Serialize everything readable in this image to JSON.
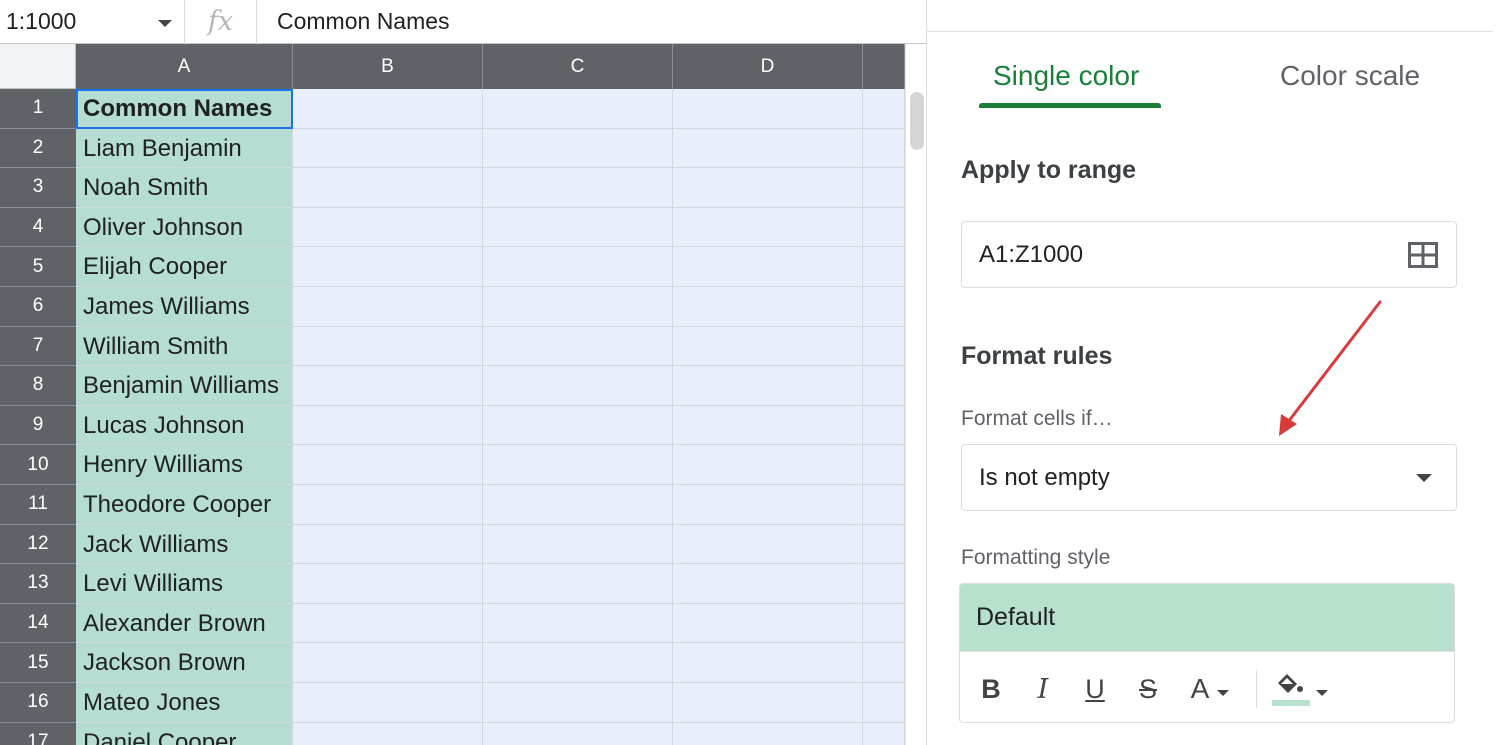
{
  "formula_bar": {
    "name_box": "1:1000",
    "fx_label": "fx",
    "value": "Common Names"
  },
  "grid": {
    "columns": [
      "A",
      "B",
      "C",
      "D"
    ],
    "rows": [
      {
        "num": "1",
        "a": "Common Names"
      },
      {
        "num": "2",
        "a": "Liam Benjamin"
      },
      {
        "num": "3",
        "a": "Noah Smith"
      },
      {
        "num": "4",
        "a": "Oliver Johnson"
      },
      {
        "num": "5",
        "a": "Elijah Cooper"
      },
      {
        "num": "6",
        "a": "James Williams"
      },
      {
        "num": "7",
        "a": "William Smith"
      },
      {
        "num": "8",
        "a": "Benjamin Williams"
      },
      {
        "num": "9",
        "a": "Lucas Johnson"
      },
      {
        "num": "10",
        "a": "Henry Williams"
      },
      {
        "num": "11",
        "a": "Theodore Cooper"
      },
      {
        "num": "12",
        "a": "Jack Williams"
      },
      {
        "num": "13",
        "a": "Levi Williams"
      },
      {
        "num": "14",
        "a": "Alexander Brown"
      },
      {
        "num": "15",
        "a": "Jackson Brown"
      },
      {
        "num": "16",
        "a": "Mateo Jones"
      },
      {
        "num": "17",
        "a": "Daniel Cooper"
      }
    ]
  },
  "panel": {
    "tabs": {
      "single": "Single color",
      "scale": "Color scale"
    },
    "apply_to_range": {
      "title": "Apply to range",
      "value": "A1:Z1000"
    },
    "format_rules": {
      "title": "Format rules",
      "condition_label": "Format cells if…",
      "condition_value": "Is not empty"
    },
    "formatting_style": {
      "label": "Formatting style",
      "preview": "Default",
      "toolbar": {
        "bold": "B",
        "italic": "I",
        "underline": "U",
        "strikethrough": "S",
        "text_color": "A"
      }
    }
  },
  "colors": {
    "accent_green": "#188038",
    "column_a_fill": "#b5ddd3",
    "range_fill": "#e8eefa",
    "preview_fill": "#b7e1cd",
    "arrow": "#d93a3a"
  }
}
